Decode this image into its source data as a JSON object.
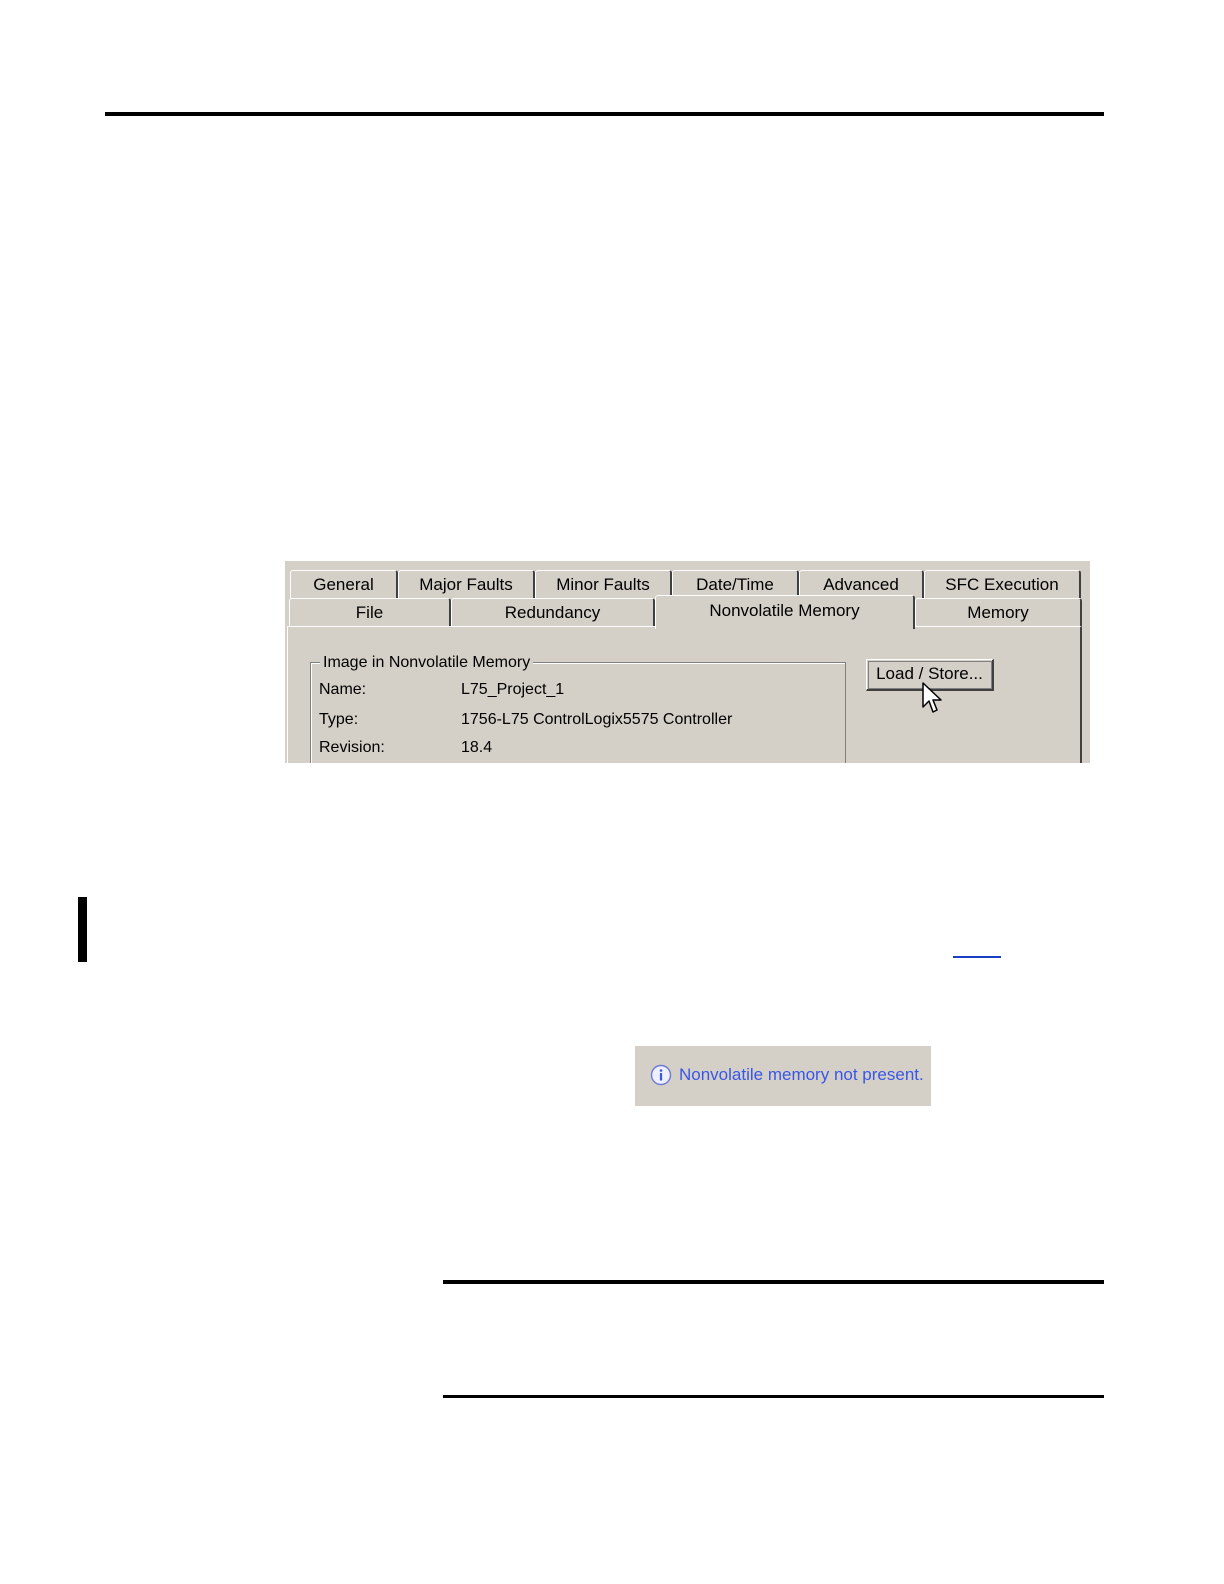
{
  "dialog": {
    "tabs_row1": [
      {
        "label": "General"
      },
      {
        "label": "Major Faults"
      },
      {
        "label": "Minor Faults"
      },
      {
        "label": "Date/Time"
      },
      {
        "label": "Advanced"
      },
      {
        "label": "SFC Execution"
      }
    ],
    "tabs_row2": [
      {
        "label": "File"
      },
      {
        "label": "Redundancy"
      },
      {
        "label": "Nonvolatile Memory",
        "active": true
      },
      {
        "label": "Memory"
      }
    ],
    "group_title": "Image in Nonvolatile Memory",
    "fields": [
      {
        "label": "Name:",
        "value": "L75_Project_1"
      },
      {
        "label": "Type:",
        "value": "1756-L75 ControlLogix5575 Controller"
      },
      {
        "label": "Revision:",
        "value": "18.4"
      }
    ],
    "load_store_button": "Load / Store...",
    "cursor_icon": "arrow-pointer-icon"
  },
  "status_message": {
    "icon": "info-icon",
    "text": "Nonvolatile memory not present.",
    "text_color": "#3a56e8"
  },
  "colors": {
    "dialog_background": "#d4d0c8",
    "page_background": "#ffffff"
  }
}
